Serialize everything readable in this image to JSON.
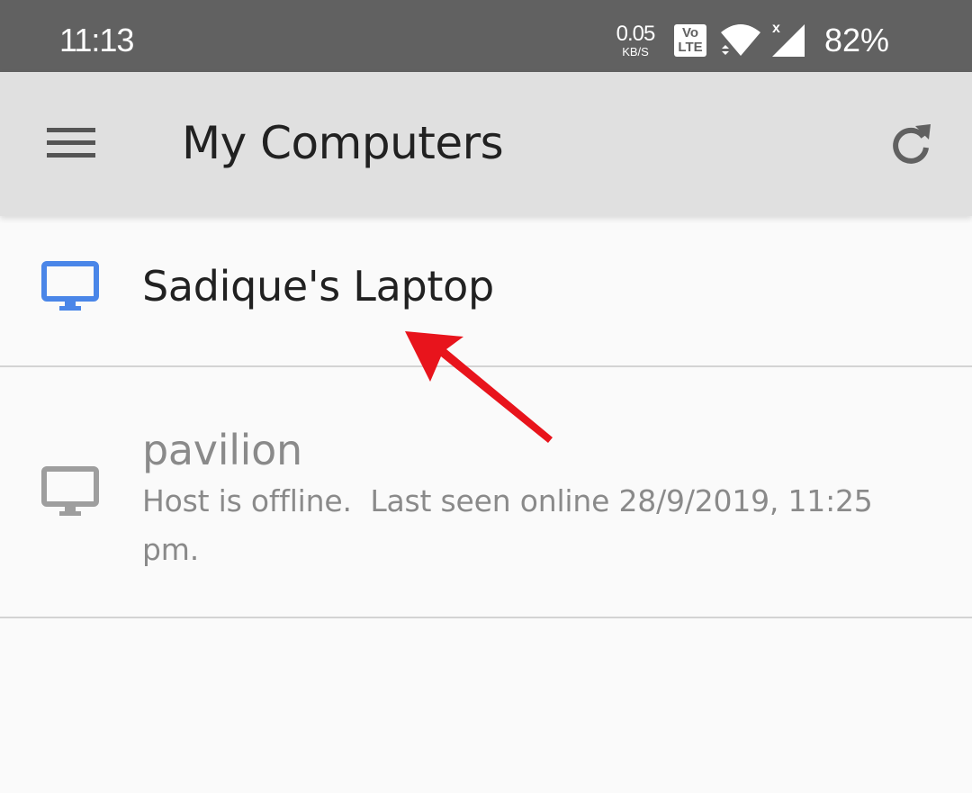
{
  "status_bar": {
    "time": "11:13",
    "net_speed_value": "0.05",
    "net_speed_unit": "KB/S",
    "volte_top": "Vo",
    "volte_bottom": "LTE",
    "battery": "82%",
    "icons": [
      "volte-icon",
      "wifi-icon",
      "cellular-signal-icon"
    ]
  },
  "app_bar": {
    "title": "My Computers",
    "menu_icon": "hamburger-menu-icon",
    "refresh_icon": "refresh-icon"
  },
  "computers": [
    {
      "name": "Sadique's Laptop",
      "status": "",
      "online": true,
      "icon": "monitor-icon",
      "icon_color": "#4a86e8"
    },
    {
      "name": "pavilion",
      "status": "Host is offline.  Last seen online 28/9/2019, 11:25 pm.",
      "online": false,
      "icon": "monitor-icon",
      "icon_color": "#9e9e9e"
    }
  ],
  "annotation": {
    "type": "arrow",
    "color": "#e8141c"
  },
  "colors": {
    "status_bar_bg": "#616161",
    "app_bar_bg": "#e0e0e0",
    "content_bg": "#fafafa"
  }
}
